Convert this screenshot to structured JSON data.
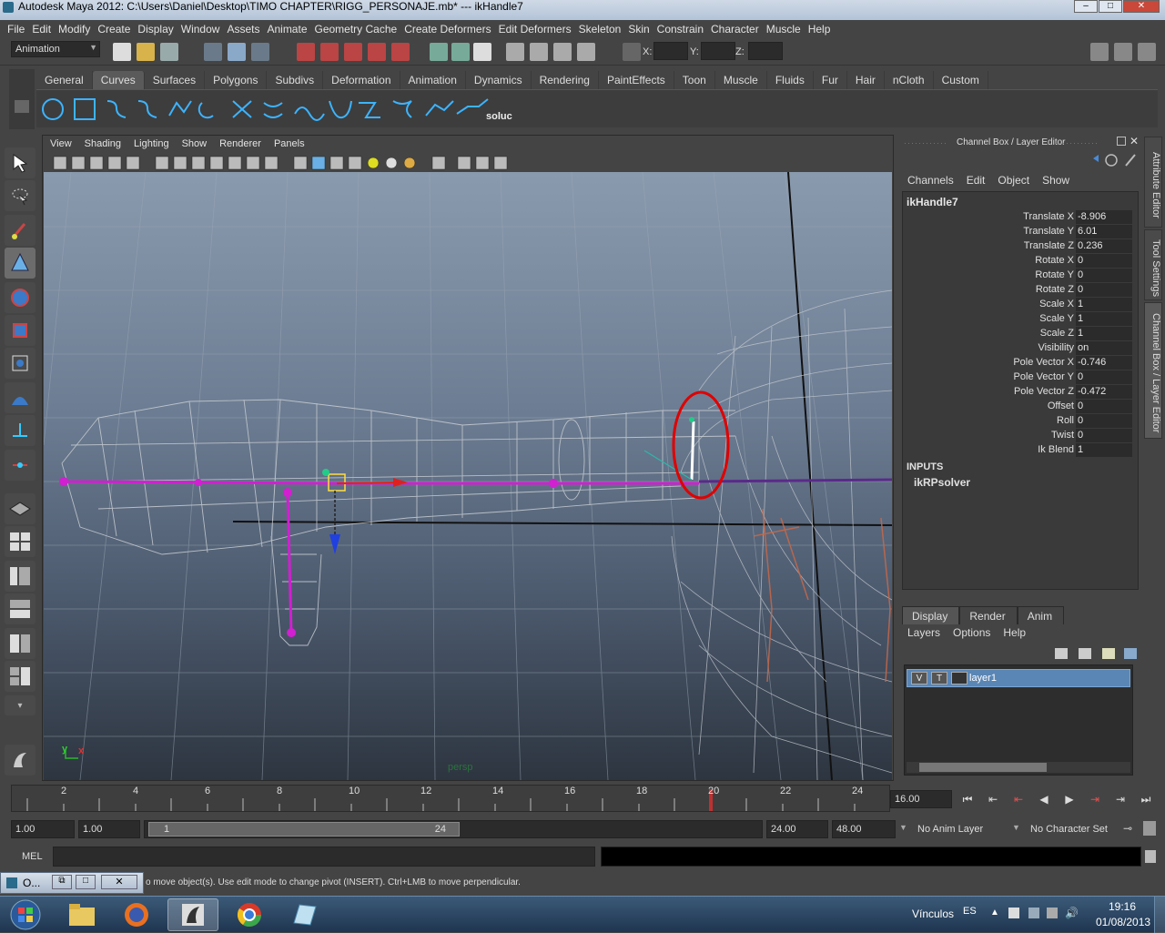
{
  "window": {
    "title": "Autodesk Maya 2012: C:\\Users\\Daniel\\Desktop\\TIMO CHAPTER\\RIGG_PERSONAJE.mb*   ---   ikHandle7"
  },
  "menubar": [
    "File",
    "Edit",
    "Modify",
    "Create",
    "Display",
    "Window",
    "Assets",
    "Animate",
    "Geometry Cache",
    "Create Deformers",
    "Edit Deformers",
    "Skeleton",
    "Skin",
    "Constrain",
    "Character",
    "Muscle",
    "Help"
  ],
  "statusline": {
    "menuset": "Animation",
    "x_label": "X:",
    "y_label": "Y:",
    "z_label": "Z:",
    "x_value": "",
    "y_value": "",
    "z_value": ""
  },
  "shelf": {
    "tabs": [
      "General",
      "Curves",
      "Surfaces",
      "Polygons",
      "Subdivs",
      "Deformation",
      "Animation",
      "Dynamics",
      "Rendering",
      "PaintEffects",
      "Toon",
      "Muscle",
      "Fluids",
      "Fur",
      "Hair",
      "nCloth",
      "Custom"
    ],
    "active_tab": "Curves",
    "last_icon_label": "soluc"
  },
  "panel": {
    "menus": [
      "View",
      "Shading",
      "Lighting",
      "Show",
      "Renderer",
      "Panels"
    ],
    "camera_label": "persp",
    "axis_y": "y",
    "axis_x": "x"
  },
  "channel_box": {
    "header": "Channel Box / Layer Editor",
    "menus": [
      "Channels",
      "Edit",
      "Object",
      "Show"
    ],
    "object_name": "ikHandle7",
    "channels": [
      {
        "label": "Translate X",
        "value": "-8.906"
      },
      {
        "label": "Translate Y",
        "value": "6.01"
      },
      {
        "label": "Translate Z",
        "value": "0.236"
      },
      {
        "label": "Rotate X",
        "value": "0"
      },
      {
        "label": "Rotate Y",
        "value": "0"
      },
      {
        "label": "Rotate Z",
        "value": "0"
      },
      {
        "label": "Scale X",
        "value": "1"
      },
      {
        "label": "Scale Y",
        "value": "1"
      },
      {
        "label": "Scale Z",
        "value": "1"
      },
      {
        "label": "Visibility",
        "value": "on"
      },
      {
        "label": "Pole Vector X",
        "value": "-0.746"
      },
      {
        "label": "Pole Vector Y",
        "value": "0"
      },
      {
        "label": "Pole Vector Z",
        "value": "-0.472"
      },
      {
        "label": "Offset",
        "value": "0"
      },
      {
        "label": "Roll",
        "value": "0"
      },
      {
        "label": "Twist",
        "value": "0"
      },
      {
        "label": "Ik Blend",
        "value": "1"
      }
    ],
    "inputs_label": "INPUTS",
    "solver": "ikRPsolver"
  },
  "layer_editor": {
    "tabs": [
      "Display",
      "Render",
      "Anim"
    ],
    "active_tab": "Display",
    "menus": [
      "Layers",
      "Options",
      "Help"
    ],
    "layer": {
      "v": "V",
      "t": "T",
      "name": "layer1"
    }
  },
  "side_tabs": [
    "Attribute Editor",
    "Tool Settings",
    "Channel Box / Layer Editor"
  ],
  "timeline": {
    "ticks": [
      "2",
      "4",
      "6",
      "8",
      "10",
      "12",
      "14",
      "16",
      "18",
      "20",
      "22",
      "24"
    ],
    "current_frame": "16.00"
  },
  "range": {
    "start": "1.00",
    "play_start": "1.00",
    "range_start_label": "1",
    "range_end_label": "24",
    "play_end": "24.00",
    "end": "48.00",
    "anim_layer": "No Anim Layer",
    "char_set": "No Character Set"
  },
  "mel": {
    "label": "MEL"
  },
  "helpline": {
    "text": "o move object(s). Use edit mode to change pivot (INSERT).  Ctrl+LMB to move perpendicular.",
    "minimized_window": "O..."
  },
  "taskbar": {
    "language": "ES",
    "links_label": "Vínculos",
    "time": "19:16",
    "date": "01/08/2013"
  },
  "colors": {
    "accent_magenta": "#d020d0",
    "highlight_red": "#e00000",
    "layer_selected": "#5a86b5"
  }
}
